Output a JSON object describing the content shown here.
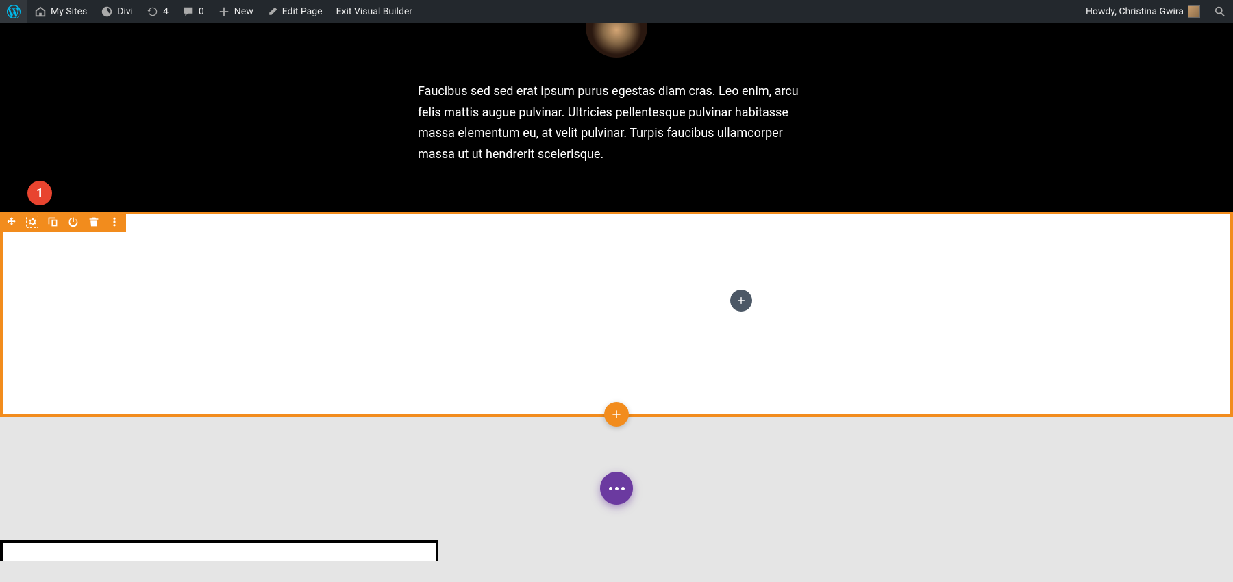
{
  "adminbar": {
    "my_sites": "My Sites",
    "site_name": "Divi",
    "updates_count": "4",
    "comments_count": "0",
    "new_label": "New",
    "edit_page": "Edit Page",
    "exit_builder": "Exit Visual Builder",
    "howdy": "Howdy, Christina Gwira"
  },
  "hero": {
    "text": "Faucibus sed sed erat ipsum purus egestas diam cras. Leo enim, arcu felis mattis augue pulvinar. Ultricies pellentesque pulvinar habitasse massa elementum eu, at velit pulvinar. Turpis faucibus ullamcorper massa ut ut hendrerit scelerisque."
  },
  "annotation": {
    "badge_1": "1"
  },
  "colors": {
    "section_accent": "#f28c1d",
    "fab": "#6b3aa0",
    "annot": "#e8442f"
  }
}
